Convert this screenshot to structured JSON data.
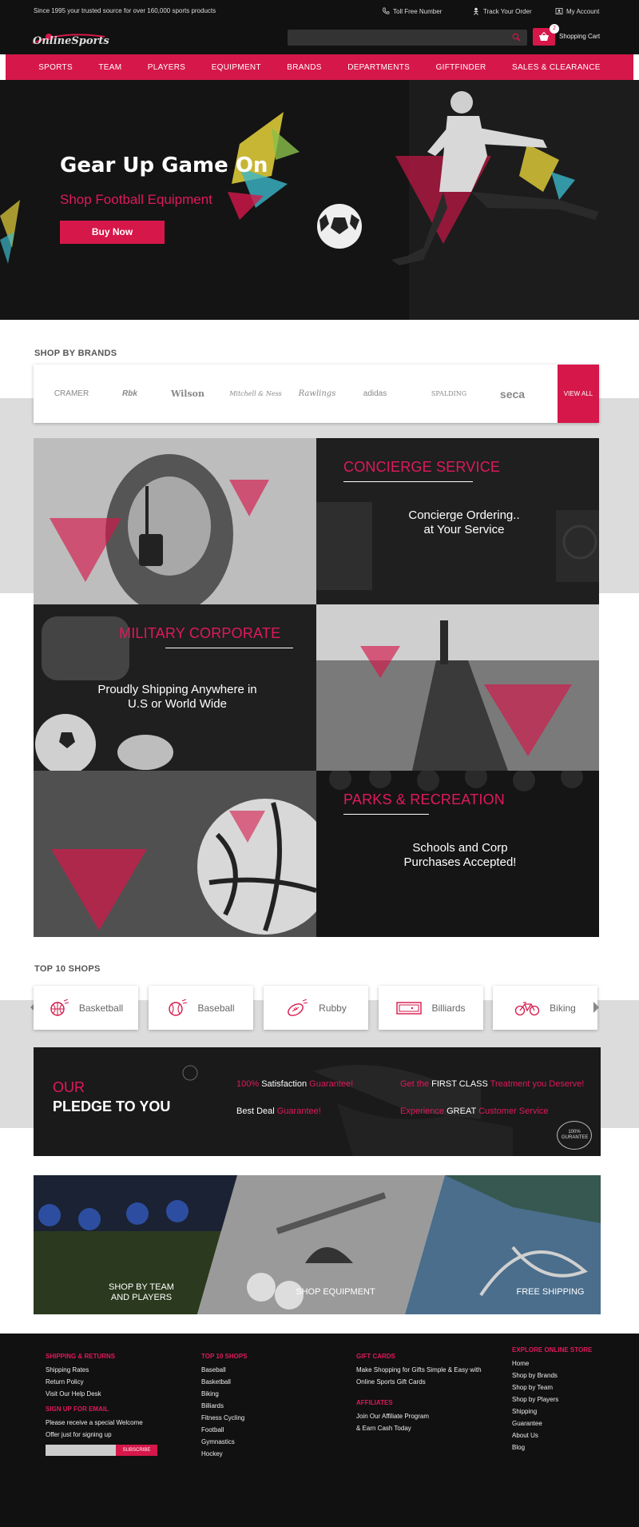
{
  "topbar": {
    "tagline": "Since 1995 your trusted source for over 160,000 sports products",
    "toll_free": "Toll Free Number",
    "track_order": "Track Your Order",
    "my_account": "My Account"
  },
  "header": {
    "logo_text": "OnlineSports",
    "cart_label": "Shopping Cart",
    "cart_count": "2"
  },
  "nav": [
    "SPORTS",
    "TEAM",
    "PLAYERS",
    "EQUIPMENT",
    "BRANDS",
    "DEPARTMENTS",
    "GIFTFINDER",
    "SALES & CLEARANCE"
  ],
  "hero": {
    "title": "Gear Up Game On",
    "subtitle": "Shop Football Equipment",
    "button": "Buy Now"
  },
  "brands": {
    "title": "SHOP BY BRANDS",
    "items": [
      "CRAMER",
      "Rbk",
      "Wilson",
      "Mitchell & Ness",
      "Rawlings",
      "adidas",
      "SPALDING",
      "seca"
    ],
    "view_all": "VIEW ALL"
  },
  "services": {
    "concierge": {
      "title": "CONCIERGE SERVICE",
      "text1": "Concierge Ordering..",
      "text2": "at Your Service"
    },
    "military": {
      "title": "MILITARY CORPORATE",
      "text1": "Proudly Shipping Anywhere in",
      "text2": "U.S or World Wide"
    },
    "parks": {
      "title": "PARKS & RECREATION",
      "text1": "Schools and Corp",
      "text2": "Purchases Accepted!"
    }
  },
  "top_shops": {
    "title": "TOP 10 SHOPS",
    "items": [
      "Basketball",
      "Baseball",
      "Rubby",
      "Billiards",
      "Biking"
    ]
  },
  "pledge": {
    "our": "OUR",
    "title": "PLEDGE TO YOU",
    "satisfaction_pct": "100%",
    "satisfaction_mid": "Satisfaction",
    "satisfaction_end": "Guarantee!",
    "best_deal": "Best Deal",
    "best_deal_end": "Guarantee!",
    "first_class_pre": "Get the",
    "first_class_mid": "FIRST CLASS",
    "first_class_end": "Treatment you Deserve!",
    "great_pre": "Experience",
    "great_mid": "GREAT",
    "great_end": "Customer Service",
    "badge": "100% GURANTEE"
  },
  "band": {
    "team_line1": "SHOP BY TEAM",
    "team_line2": "AND PLAYERS",
    "equipment": "SHOP EQUIPMENT",
    "shipping": "FREE SHIPPING"
  },
  "footer": {
    "shipping_title": "SHIPPING & RETURNS",
    "shipping_items": [
      "Shipping Rates",
      "Return Policy",
      "Visit Our Help Desk"
    ],
    "signup_title": "SIGN UP FOR EMAIL",
    "signup_line1": "Please receive a special Welcome",
    "signup_line2": "Offer just for signing up",
    "subscribe": "SUBSCRIBE",
    "shops_title": "TOP 10 SHOPS",
    "shops_items": [
      "Baseball",
      "Basketball",
      "Biking",
      "Billiards",
      "Fitness Cycling",
      "Football",
      "Gymnastics",
      "Hockey"
    ],
    "gift_title": "GIFT CARDS",
    "gift_line1": "Make Shopping for Gifts Simple & Easy with",
    "gift_line2": "Online Sports Gift Cards",
    "aff_title": "AFFILIATES",
    "aff_line1": "Join Our Affiliate Program",
    "aff_line2": "& Earn Cash Today",
    "explore_title": "EXPLORE ONLINE STORE",
    "explore_items": [
      "Home",
      "Shop by Brands",
      "Shop by Team",
      "Shop by Players",
      "Shipping",
      "Guarantee",
      "About Us",
      "Blog"
    ]
  },
  "colors": {
    "accent": "#d6174a",
    "dark": "#111111"
  }
}
